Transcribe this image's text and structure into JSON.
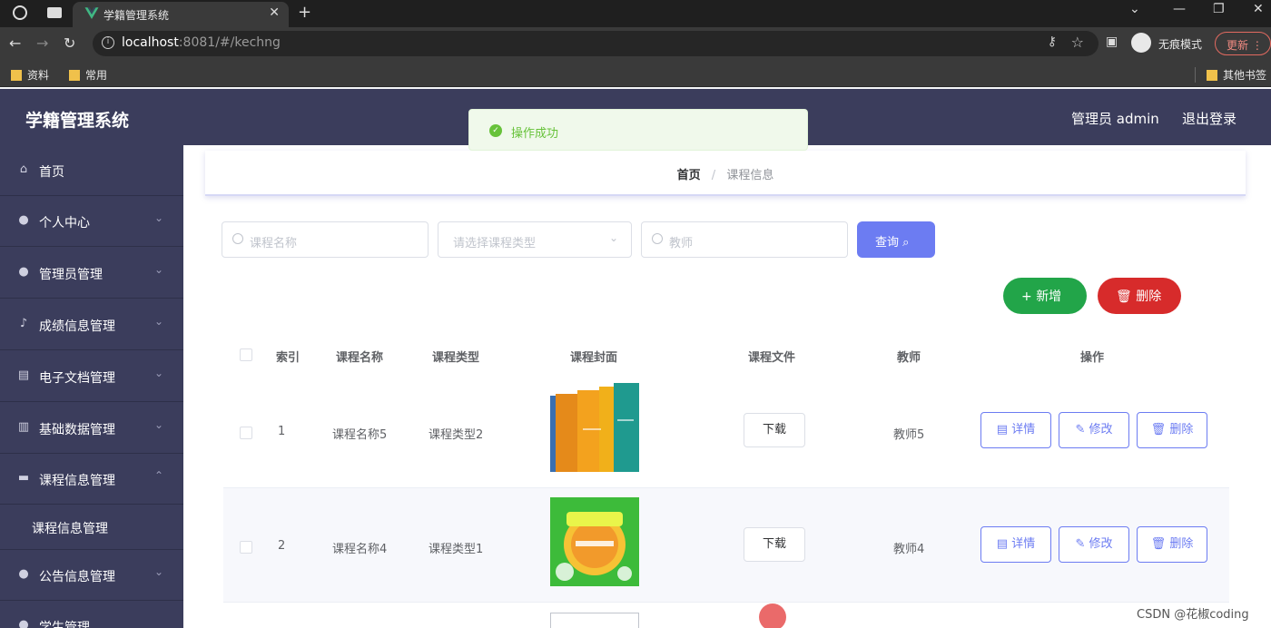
{
  "browser": {
    "tab_title": "学籍管理系统",
    "url_host": "localhost",
    "url_path": ":8081/#/kechng",
    "incognito_label": "无痕模式",
    "update_label": "更新",
    "bookmarks": [
      "资料",
      "常用"
    ],
    "other_bookmarks": "其他书签"
  },
  "app": {
    "title": "学籍管理系统",
    "admin_label": "管理员 admin",
    "logout_label": "退出登录",
    "toast": "操作成功"
  },
  "sidebar": {
    "items": [
      {
        "label": "首页",
        "icon": "home-icon"
      },
      {
        "label": "个人中心",
        "icon": "user-icon"
      },
      {
        "label": "管理员管理",
        "icon": "bulb-icon"
      },
      {
        "label": "成绩信息管理",
        "icon": "mic-icon"
      },
      {
        "label": "电子文档管理",
        "icon": "document-icon"
      },
      {
        "label": "基础数据管理",
        "icon": "bar-chart-icon"
      },
      {
        "label": "课程信息管理",
        "icon": "chat-icon"
      },
      {
        "label": "课程信息管理",
        "icon": ""
      },
      {
        "label": "公告信息管理",
        "icon": "user-icon"
      },
      {
        "label": "学生管理",
        "icon": "user-icon"
      }
    ]
  },
  "breadcrumb": {
    "home": "首页",
    "separator": "/",
    "current": "课程信息"
  },
  "search": {
    "course_name_placeholder": "课程名称",
    "course_type_placeholder": "请选择课程类型",
    "teacher_placeholder": "教师",
    "query_label": "查询"
  },
  "actions": {
    "add_label": "新增",
    "delete_label": "删除"
  },
  "table": {
    "headers": [
      "索引",
      "课程名称",
      "课程类型",
      "课程封面",
      "课程文件",
      "教师",
      "操作"
    ],
    "rows": [
      {
        "index": "1",
        "name": "课程名称5",
        "type": "课程类型2",
        "file_label": "下载",
        "teacher": "教师5",
        "ops": [
          "详情",
          "修改",
          "删除"
        ]
      },
      {
        "index": "2",
        "name": "课程名称4",
        "type": "课程类型1",
        "file_label": "下载",
        "teacher": "教师4",
        "ops": [
          "详情",
          "修改",
          "删除"
        ]
      }
    ]
  },
  "watermark": "CSDN @花椒coding"
}
